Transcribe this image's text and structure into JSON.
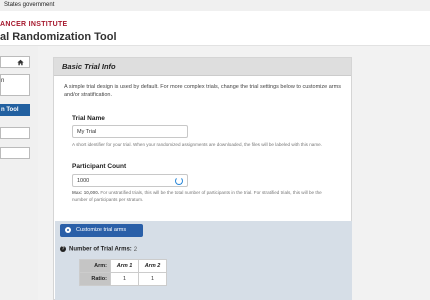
{
  "gov_banner": "States government",
  "header": {
    "institute": "ANCER INSTITUTE",
    "title": "al Randomization Tool"
  },
  "sidebar": {
    "items": [
      {
        "label": "",
        "icon": "home-icon"
      },
      {
        "label": "n"
      },
      {
        "label": "n Tool",
        "active": true
      },
      {
        "label": ""
      },
      {
        "label": ""
      }
    ]
  },
  "card": {
    "title": "Basic Trial Info",
    "intro": "A simple trial design is used by default. For more complex trials, change the trial settings below to customize arms and/or stratification.",
    "trial_name": {
      "label": "Trial Name",
      "value": "My Trial",
      "help": "A short identifier for your trial. When your randomized assignments are downloaded, the files will be labeled with this name."
    },
    "participant_count": {
      "label": "Participant Count",
      "value": "1000",
      "help_bold": "Max: 10,000.",
      "help": "For unstratified trials, this will be the total number of participants in the trial. For stratified trials, this will be the number of participants per stratum."
    },
    "arms": {
      "button_label": "Customize trial arms",
      "num_label": "Number of Trial Arms:",
      "num_value": "2",
      "row_arm": "Arm:",
      "row_ratio": "Ratio:",
      "columns": [
        "Arm 1",
        "Arm 2"
      ],
      "ratios": [
        "1",
        "1"
      ]
    }
  },
  "colors": {
    "brand_red": "#a6192e",
    "active_blue": "#2260a0",
    "button_blue": "#2a5fa8"
  }
}
